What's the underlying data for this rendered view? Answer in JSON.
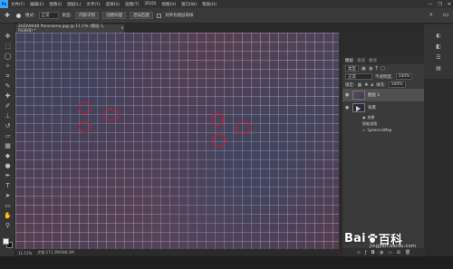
{
  "app": {
    "logo": "Ps"
  },
  "menu": [
    "文件(F)",
    "编辑(E)",
    "图像(I)",
    "图层(L)",
    "文字(Y)",
    "选择(S)",
    "滤镜(T)",
    "3D(D)",
    "视图(V)",
    "窗口(W)",
    "帮助(H)"
  ],
  "window_controls": [
    "—",
    "❐",
    "✕"
  ],
  "options": {
    "mode_label": "模式:",
    "mode_value": "正常",
    "type_label": "类型:",
    "btn_proximity": "内容识别",
    "btn_create": "创建纹理",
    "btn_proximity_match": "近似匹配",
    "sample_all": "对所有图层取样"
  },
  "document": {
    "tab_title": "20ZA9440 Panorama.jpg @ 11.1% (图层 1, RGB/8) *",
    "close": "×"
  },
  "status": {
    "zoom": "11.11%",
    "doc": "文档:171.3M/368.3M"
  },
  "layers_panel": {
    "tabs": [
      "图层",
      "通道",
      "路径"
    ],
    "kind_label": "类型",
    "blend_mode": "正常",
    "opacity_label": "不透明度:",
    "opacity_value": "100%",
    "lock_label": "锁定:",
    "fill_label": "填充:",
    "fill_value": "100%",
    "layers": [
      {
        "name": "图层 1",
        "selected": true
      },
      {
        "name": "背景",
        "selected": false
      }
    ],
    "effects_label": "效果",
    "filter_label": "智能滤镜",
    "filter_item": "SphericalMap"
  },
  "watermark": {
    "brand_a": "Bai",
    "brand_b": "百科",
    "sub": "jingyan.baidu.com"
  },
  "colors": {
    "accent": "#31a8ff",
    "marker": "#d11a2a"
  },
  "icons": [
    "move-icon",
    "marquee-icon",
    "lasso-icon",
    "magic-wand-icon",
    "crop-icon",
    "eyedropper-icon",
    "healing-brush-icon",
    "brush-icon",
    "stamp-icon",
    "history-brush-icon",
    "eraser-icon",
    "gradient-icon",
    "blur-icon",
    "dodge-icon",
    "pen-icon",
    "type-icon",
    "path-select-icon",
    "shape-icon",
    "hand-icon",
    "zoom-icon"
  ]
}
